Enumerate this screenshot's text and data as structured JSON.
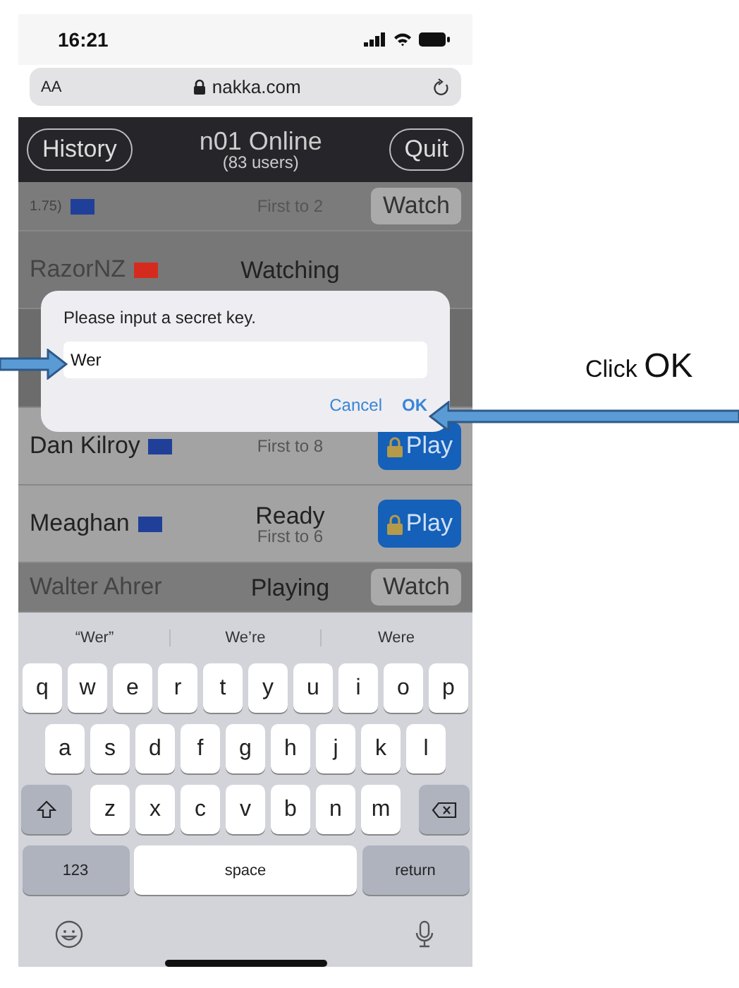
{
  "status_bar": {
    "time": "16:21"
  },
  "address_bar": {
    "text_size": "AA",
    "url": "nakka.com"
  },
  "header": {
    "left_button": "History",
    "title": "n01 Online",
    "subtitle": "(83 users)",
    "right_button": "Quit"
  },
  "players": [
    {
      "kind": "playing",
      "name": "1.75)",
      "flag": {
        "color": "#1f3f99"
      },
      "detail": "First to 2",
      "action": "Watch"
    },
    {
      "kind": "watching",
      "name": "RazorNZ",
      "flag": {
        "color": "#d52b1e"
      },
      "status": "Watching"
    },
    {
      "kind": "hidden"
    },
    {
      "kind": "ready",
      "name": "Dan Kilroy",
      "flag": {
        "color": "#1f3f99"
      },
      "detail": "First to 8",
      "action": "Play"
    },
    {
      "kind": "ready",
      "name": "Meaghan",
      "flag": {
        "color": "#1f3f99"
      },
      "status": "Ready",
      "detail": "First to 6",
      "action": "Play"
    },
    {
      "kind": "playing",
      "name": "Walter Ahrer",
      "status": "Playing",
      "action": "Watch"
    }
  ],
  "dialog": {
    "message": "Please input a secret key.",
    "value": "Wer",
    "buttons": [
      "Cancel",
      "OK"
    ]
  },
  "keyboard": {
    "suggestions": [
      "“Wer”",
      "We’re",
      "Were"
    ],
    "rows": [
      [
        "q",
        "w",
        "e",
        "r",
        "t",
        "y",
        "u",
        "i",
        "o",
        "p"
      ],
      [
        "a",
        "s",
        "d",
        "f",
        "g",
        "h",
        "j",
        "k",
        "l"
      ],
      [
        "z",
        "x",
        "c",
        "v",
        "b",
        "n",
        "m"
      ]
    ],
    "numbers_key": "123",
    "space_key": "space",
    "return_key": "return"
  },
  "annotation": {
    "label": "Click",
    "emphasis": "OK"
  }
}
